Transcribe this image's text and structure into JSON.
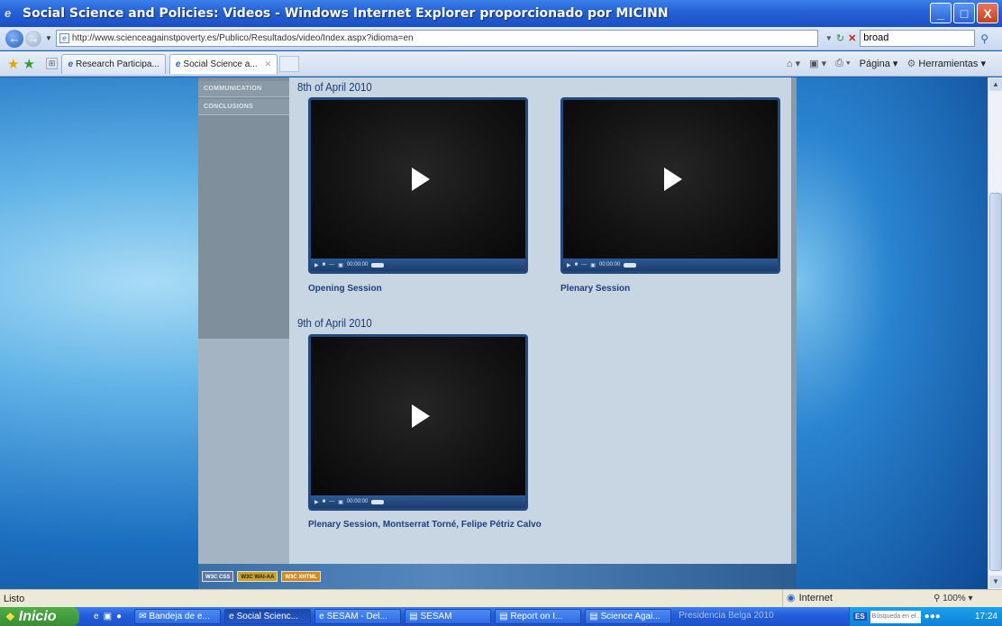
{
  "window": {
    "title": "Social Science and Policies: Videos - Windows Internet Explorer proporcionado por MICINN",
    "buttons": [
      "_",
      "□",
      "X"
    ]
  },
  "address": {
    "url": "http://www.scienceagainstpoverty.es/Publico/Resultados/video/Index.aspx?idioma=en",
    "search_value": "broad"
  },
  "tabs": [
    {
      "label": "Research Participa...",
      "active": false
    },
    {
      "label": "Social Science a...",
      "active": true
    }
  ],
  "command_bar": {
    "page_label": "Página",
    "tools_label": "Herramientas"
  },
  "sidebar": {
    "items": [
      "COMMUNICATION",
      "CONCLUSIONS"
    ]
  },
  "sessions": [
    {
      "date": "8th of April 2010",
      "videos": [
        {
          "title": "Opening Session",
          "time": "00:00:00"
        },
        {
          "title": "Plenary Session",
          "time": "00:00:00"
        }
      ]
    },
    {
      "date": "9th of April 2010",
      "videos": [
        {
          "title": "Plenary Session, Montserrat Torné, Felipe Pétriz Calvo",
          "time": "00:00:00"
        }
      ]
    }
  ],
  "footer": {
    "badges": [
      "W3C CSS",
      "W3C WAI-AA",
      "W3C XHTML"
    ]
  },
  "status": {
    "text": "Listo",
    "zone": "Internet",
    "zoom": "100%"
  },
  "taskbar": {
    "start_label": "Inicio",
    "tasks": [
      {
        "label": "Bandeja de e...",
        "active": false
      },
      {
        "label": "Social Scienc...",
        "active": true
      },
      {
        "label": "SESAM - Del...",
        "active": false
      },
      {
        "label": "SESAM",
        "active": false
      },
      {
        "label": "Report on I...",
        "active": false
      },
      {
        "label": "Science Agai...",
        "active": false
      }
    ],
    "inactive_text": "Presidencia Belga 2010",
    "lang": "ES",
    "search_placeholder": "Búsqueda en el...",
    "clock": "17:24"
  },
  "colors": {
    "titlebar": "#2560d6",
    "page_bg": "#c8d6e3",
    "video_border": "#234a7e",
    "video_title": "#1f3f7c"
  }
}
